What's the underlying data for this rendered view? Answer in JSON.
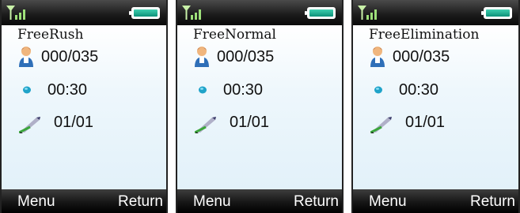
{
  "screens": [
    {
      "mode_title": "FreeRush",
      "players": "000/035",
      "time": "00:30",
      "level": "01/01",
      "softkeys": {
        "left": "Menu",
        "right": "Return"
      }
    },
    {
      "mode_title": "FreeNormal",
      "players": "000/035",
      "time": "00:30",
      "level": "01/01",
      "softkeys": {
        "left": "Menu",
        "right": "Return"
      }
    },
    {
      "mode_title": "FreeElimination",
      "players": "000/035",
      "time": "00:30",
      "level": "01/01",
      "softkeys": {
        "left": "Menu",
        "right": "Return"
      }
    }
  ],
  "icons": {
    "status": [
      "signal-strength-icon",
      "battery-icon"
    ],
    "rows": [
      "player-icon",
      "timer-dot-icon",
      "pen-icon"
    ]
  },
  "colors": {
    "screen_background": "#e8f4fb",
    "status_bar": "#1a1a1a",
    "battery_fill": "#1aa88c",
    "signal": "#9ee07a",
    "timer_dot": "#1fa3c9"
  }
}
